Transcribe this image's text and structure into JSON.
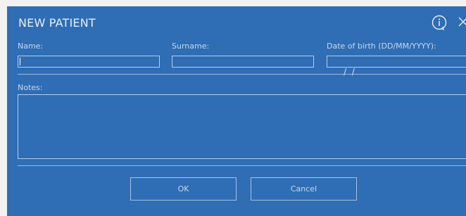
{
  "dialog": {
    "title": "NEW PATIENT",
    "info_icon": "info-icon",
    "close_icon": "close-icon"
  },
  "form": {
    "name_label": "Name:",
    "name_value": "",
    "surname_label": "Surname:",
    "surname_value": "",
    "dob_label": "Date of birth (DD/MM/YYYY):",
    "dob_value": " /  /",
    "notes_label": "Notes:",
    "notes_value": ""
  },
  "buttons": {
    "ok_label": "OK",
    "cancel_label": "Cancel"
  },
  "colors": {
    "background": "#2f6db4",
    "border": "#b9cde6",
    "text": "#c9d8ec"
  }
}
